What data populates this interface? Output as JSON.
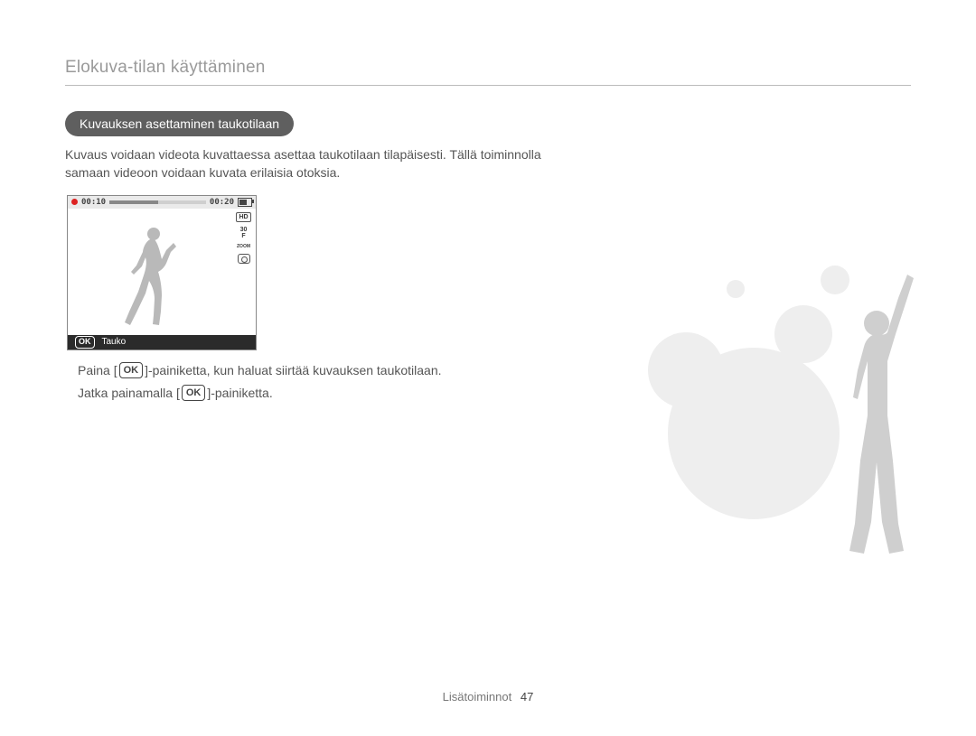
{
  "header": {
    "title": "Elokuva-tilan käyttäminen"
  },
  "section": {
    "pill": "Kuvauksen asettaminen taukotilaan",
    "paragraph": "Kuvaus voidaan videota kuvattaessa asettaa taukotilaan tilapäisesti. Tällä toiminnolla samaan videoon voidaan kuvata erilaisia otoksia."
  },
  "screen": {
    "time_left": "00:10",
    "time_right": "00:20",
    "progress_pct": 50,
    "battery_pct": 80,
    "side_hd": "HD",
    "side_fps": "30\nF",
    "side_zoom": "ZOOM",
    "bottom_label": "Tauko",
    "ok_text": "OK"
  },
  "instructions": {
    "l1_a": "Paina [",
    "l1_b": "]-painiketta, kun haluat siirtää kuvauksen taukotilaan.",
    "l2_a": "Jatka painamalla [",
    "l2_b": "]-painiketta."
  },
  "footer": {
    "section_label": "Lisätoiminnot",
    "page_number": "47"
  }
}
